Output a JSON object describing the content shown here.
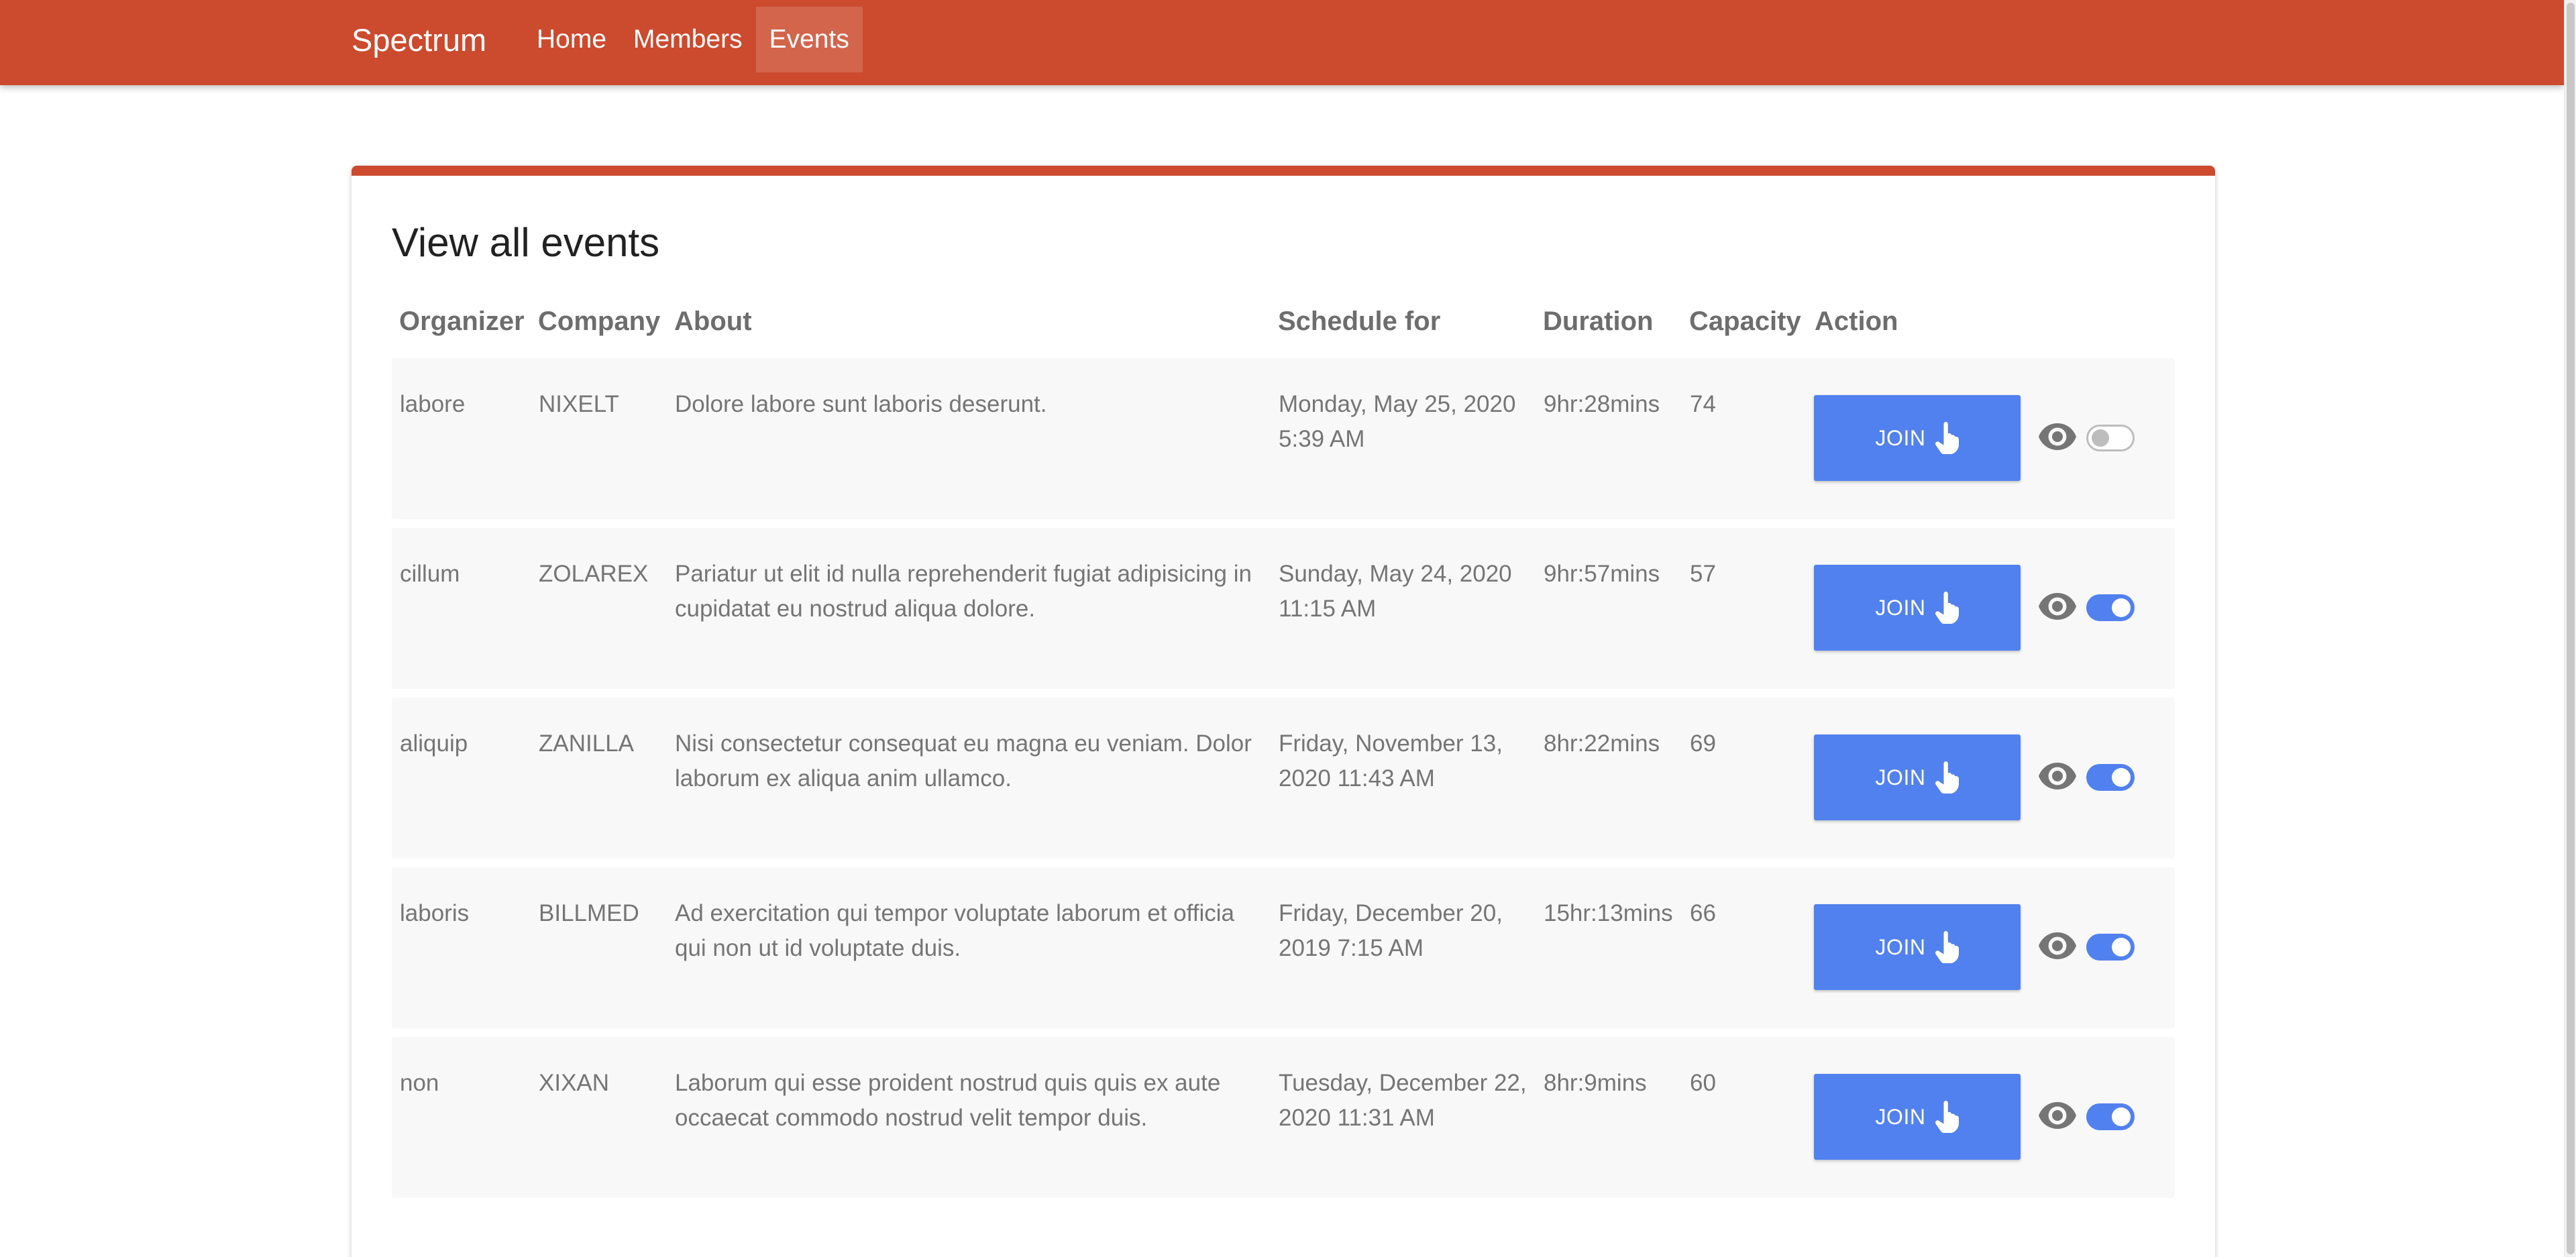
{
  "colors": {
    "brand": "#cc4a2e",
    "accent": "#5181ee"
  },
  "navbar": {
    "brand": "Spectrum",
    "links": [
      {
        "label": "Home",
        "active": false
      },
      {
        "label": "Members",
        "active": false
      },
      {
        "label": "Events",
        "active": true
      }
    ]
  },
  "events": {
    "title": "View all events",
    "columns": [
      "Organizer",
      "Company",
      "About",
      "Schedule for",
      "Duration",
      "Capacity",
      "Action"
    ],
    "join_label": "JOIN",
    "join_icon": "touch-hand-icon",
    "view_icon": "eye-icon",
    "rows": [
      {
        "organizer": "labore",
        "company": "NIXELT",
        "about": "Dolore labore sunt laboris deserunt.",
        "schedule": "Monday, May 25, 2020 5:39 AM",
        "duration": "9hr:28mins",
        "capacity": "74",
        "enabled": false
      },
      {
        "organizer": "cillum",
        "company": "ZOLAREX",
        "about": "Pariatur ut elit id nulla reprehenderit fugiat adipisicing in cupidatat eu nostrud aliqua dolore.",
        "schedule": "Sunday, May 24, 2020 11:15 AM",
        "duration": "9hr:57mins",
        "capacity": "57",
        "enabled": true
      },
      {
        "organizer": "aliquip",
        "company": "ZANILLA",
        "about": "Nisi consectetur consequat eu magna eu veniam. Dolor laborum ex aliqua anim ullamco.",
        "schedule": "Friday, November 13, 2020 11:43 AM",
        "duration": "8hr:22mins",
        "capacity": "69",
        "enabled": true
      },
      {
        "organizer": "laboris",
        "company": "BILLMED",
        "about": "Ad exercitation qui tempor voluptate laborum et officia qui non ut id voluptate duis.",
        "schedule": "Friday, December 20, 2019 7:15 AM",
        "duration": "15hr:13mins",
        "capacity": "66",
        "enabled": true
      },
      {
        "organizer": "non",
        "company": "XIXAN",
        "about": "Laborum qui esse proident nostrud quis quis ex aute occaecat commodo nostrud velit tempor duis.",
        "schedule": "Tuesday, December 22, 2020 11:31 AM",
        "duration": "8hr:9mins",
        "capacity": "60",
        "enabled": true
      }
    ]
  }
}
